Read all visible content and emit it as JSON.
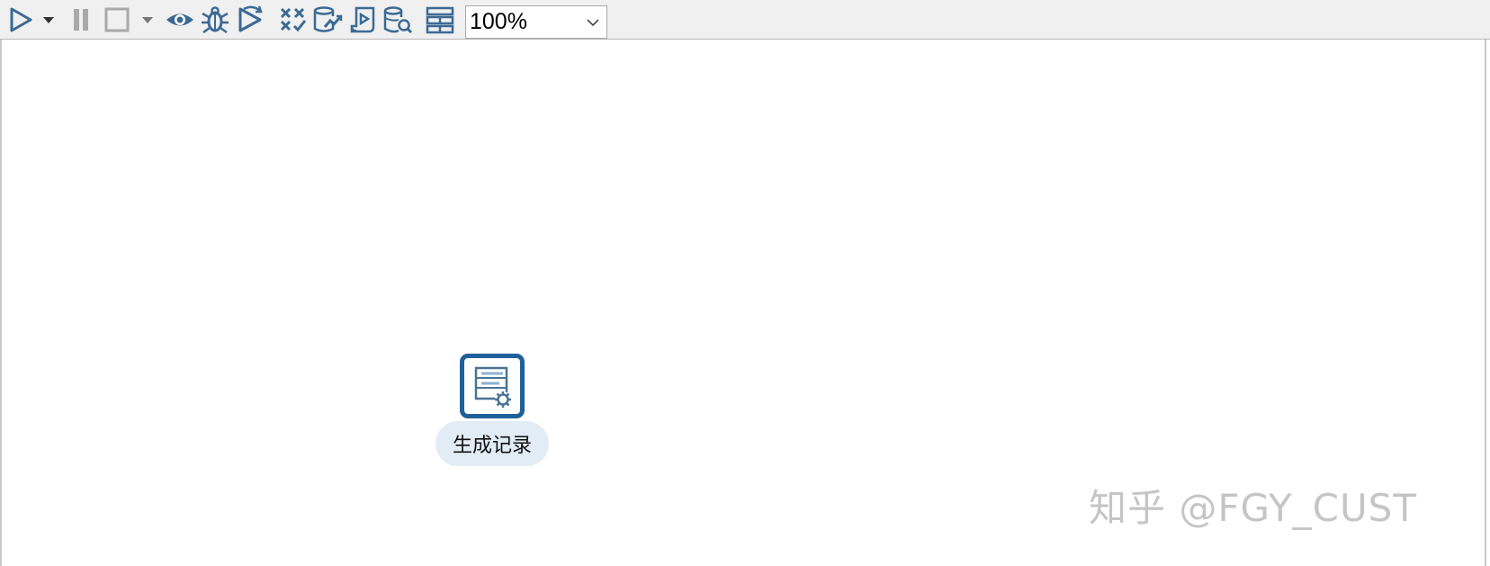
{
  "toolbar": {
    "icons": [
      "run-icon",
      "run-dropdown-arrow-icon",
      "pause-icon",
      "stop-icon",
      "stop-dropdown-arrow-icon",
      "preview-eye-icon",
      "debug-bug-icon",
      "replay-icon",
      "verify-icon",
      "impact-analysis-icon",
      "generate-sql-icon",
      "explore-database-icon",
      "show-results-icon"
    ],
    "zoom": {
      "selected": "100%"
    }
  },
  "canvas": {
    "step": {
      "icon": "generate-rows-icon",
      "label": "生成记录"
    },
    "watermark": "知乎 @FGY_CUST"
  },
  "colors": {
    "icon_blue": "#3b6a94",
    "node_border": "#1f5f9a",
    "label_bg": "#e2ecf5",
    "toolbar_bg": "#f0f0f0"
  }
}
